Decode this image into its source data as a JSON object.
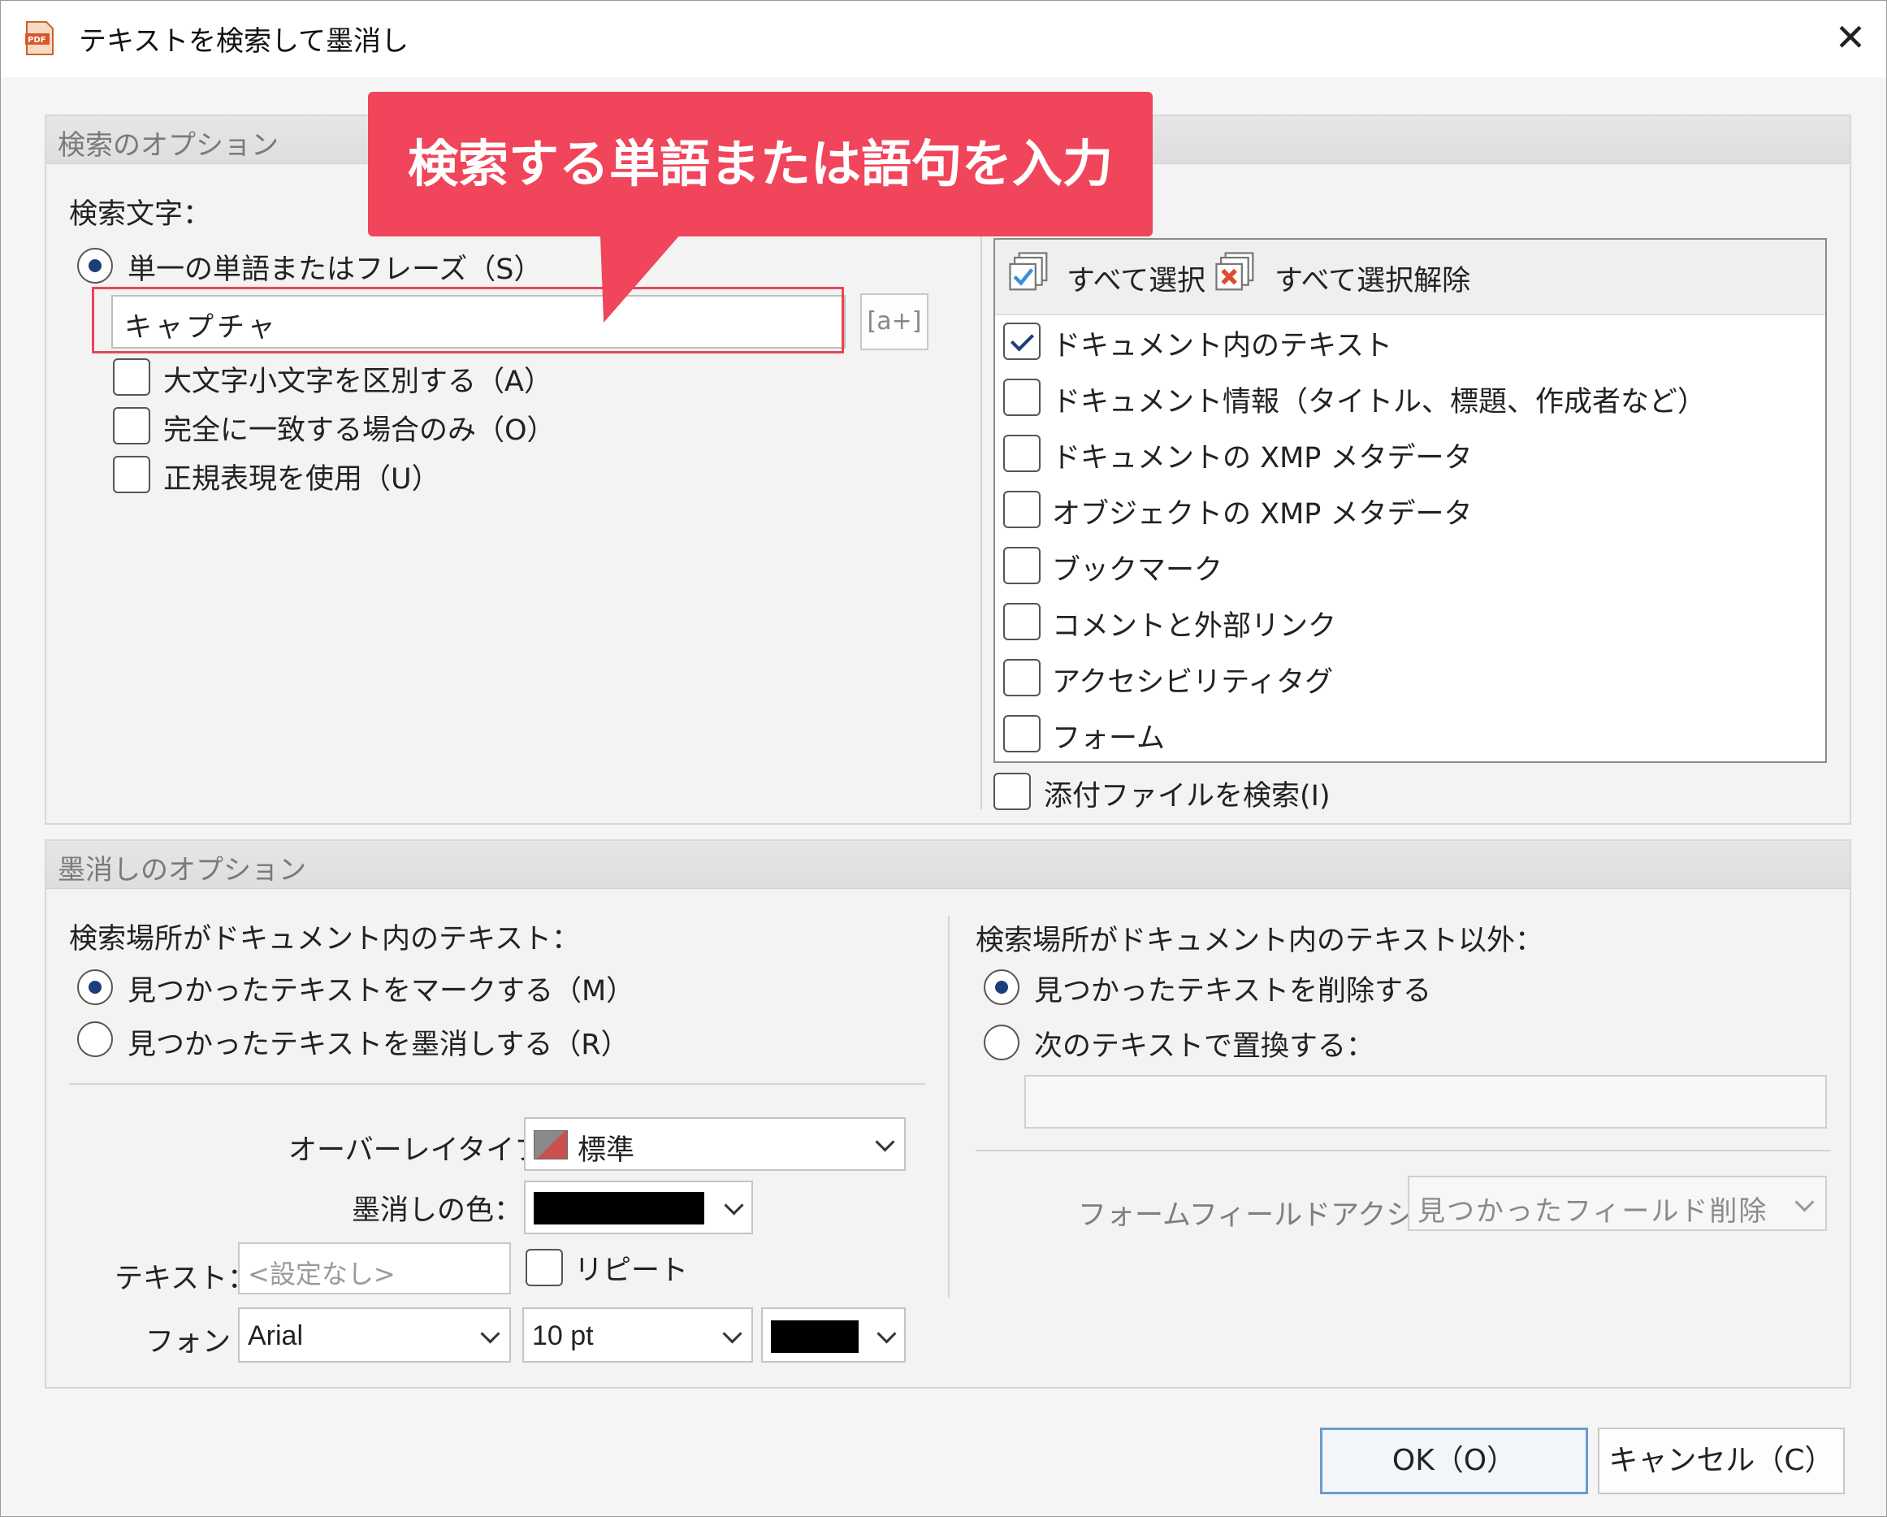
{
  "window": {
    "title": "テキストを検索して墨消し",
    "close_glyph": "✕"
  },
  "callout": {
    "text": "検索する単語または語句を入力"
  },
  "search_options": {
    "group_title": "検索のオプション",
    "search_text_label": "検索文字：",
    "single_word_radio_label": "単一の単語またはフレーズ（S）",
    "search_input_value": "キャプチャ",
    "regex_helper_button": "[a+]",
    "case_sensitive_label": "大文字小文字を区別する（A）",
    "whole_word_label": "完全に一致する場合のみ（O）",
    "regex_label": "正規表現を使用（U）"
  },
  "search_scope": {
    "select_all_label": "すべて選択",
    "deselect_all_label": "すべて選択解除",
    "items": [
      {
        "label": "ドキュメント内のテキスト",
        "checked": true
      },
      {
        "label": "ドキュメント情報（タイトル、標題、作成者など）",
        "checked": false
      },
      {
        "label": "ドキュメントの XMP メタデータ",
        "checked": false
      },
      {
        "label": "オブジェクトの XMP メタデータ",
        "checked": false
      },
      {
        "label": "ブックマーク",
        "checked": false
      },
      {
        "label": "コメントと外部リンク",
        "checked": false
      },
      {
        "label": "アクセシビリティタグ",
        "checked": false
      },
      {
        "label": "フォーム",
        "checked": false
      }
    ],
    "attachments_label": "添付ファイルを検索(I)"
  },
  "redaction_options": {
    "group_title": "墨消しのオプション",
    "in_text_header": "検索場所がドキュメント内のテキスト：",
    "mark_label": "見つかったテキストをマークする（M）",
    "redact_label": "見つかったテキストを墨消しする（R）",
    "overlay_type_label": "オーバーレイタイプ：",
    "overlay_type_value": "標準",
    "redaction_color_label": "墨消しの色：",
    "redaction_color": "#000000",
    "text_label": "テキスト：",
    "text_placeholder": "<設定なし>",
    "repeat_label": "リピート",
    "font_label": "フォント",
    "font_value": "Arial",
    "font_size_value": "10 pt",
    "font_color": "#000000",
    "outside_text_header": "検索場所がドキュメント内のテキスト以外：",
    "delete_label": "見つかったテキストを削除する",
    "replace_label": "次のテキストで置換する：",
    "form_field_action_label": "フォームフィールドアクション：",
    "form_field_action_value": "見つかったフィールド削除"
  },
  "footer": {
    "ok_label": "OK（O）",
    "cancel_label": "キャンセル（C）"
  },
  "colors": {
    "callout": "#f0455a",
    "radio_dot": "#1c3f7a",
    "highlight_box": "#e8455a"
  }
}
